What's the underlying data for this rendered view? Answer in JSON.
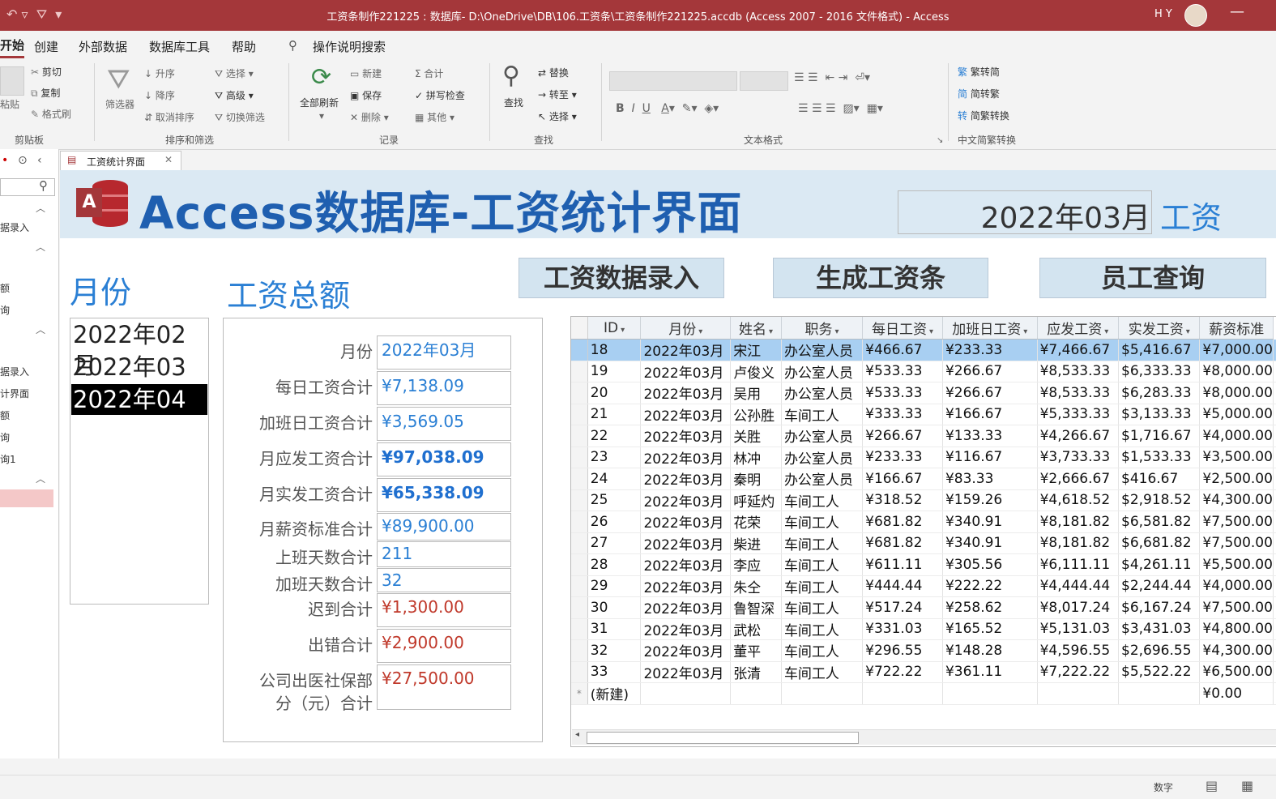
{
  "window": {
    "title": "工资条制作221225 : 数据库- D:\\OneDrive\\DB\\106.工资条\\工资条制作221225.accdb (Access 2007 - 2016 文件格式) - Access",
    "user": "H Y"
  },
  "menu": {
    "home": "开始",
    "create": "创建",
    "external": "外部数据",
    "dbtools": "数据库工具",
    "help": "帮助",
    "search": "操作说明搜索"
  },
  "ribbon": {
    "clipboard": {
      "paste": "粘贴",
      "cut": "剪切",
      "copy": "复制",
      "format_painter": "格式刷",
      "label": "剪贴板"
    },
    "sort": {
      "filter": "筛选器",
      "asc": "升序",
      "desc": "降序",
      "clear": "取消排序",
      "select": "选择",
      "advanced": "高级",
      "toggle": "切换筛选",
      "label": "排序和筛选"
    },
    "records": {
      "refresh": "全部刷新",
      "new": "新建",
      "save": "保存",
      "delete": "删除",
      "total": "合计",
      "spell": "拼写检查",
      "more": "其他",
      "label": "记录"
    },
    "find": {
      "find": "查找",
      "replace": "替换",
      "goto": "转至",
      "select": "选择",
      "label": "查找"
    },
    "text": {
      "label": "文本格式"
    },
    "chinese": {
      "t2s": "繁转简",
      "s2t": "简转繁",
      "convert": "简繁转换",
      "label": "中文简繁转换"
    }
  },
  "nav": {
    "items": [
      "据录入",
      "额",
      "询",
      "据录入",
      "计界面",
      "额",
      "询",
      "询1"
    ]
  },
  "doc_tab": "工资统计界面",
  "form": {
    "title": "Access数据库-工资统计界面",
    "current_month": "2022年03月",
    "wage_label": "工资",
    "buttons": {
      "entry": "工资数据录入",
      "slip": "生成工资条",
      "query": "员工查询"
    },
    "month_label": "月份",
    "total_label": "工资总额",
    "months": [
      "2022年02月",
      "2022年03月",
      "2022年04月"
    ],
    "summary": [
      {
        "label": "月份",
        "value": "2022年03月"
      },
      {
        "label": "每日工资合计",
        "value": "¥7,138.09"
      },
      {
        "label": "加班日工资合计",
        "value": "¥3,569.05"
      },
      {
        "label": "月应发工资合计",
        "value": "¥97,038.09"
      },
      {
        "label": "月实发工资合计",
        "value": "¥65,338.09"
      },
      {
        "label": "月薪资标准合计",
        "value": "¥89,900.00"
      },
      {
        "label": "上班天数合计",
        "value": "211"
      },
      {
        "label": "加班天数合计",
        "value": "32"
      },
      {
        "label": "迟到合计",
        "value": "¥1,300.00"
      },
      {
        "label": "出错合计",
        "value": "¥2,900.00"
      },
      {
        "label": "公司出医社保部",
        "value": "¥27,500.00"
      },
      {
        "label": "分（元）合计",
        "value": ""
      }
    ]
  },
  "datasheet": {
    "columns": [
      "ID",
      "月份",
      "姓名",
      "职务",
      "每日工资",
      "加班日工资",
      "应发工资",
      "实发工资",
      "薪资标准"
    ],
    "rows": [
      [
        "18",
        "2022年03月",
        "宋江",
        "办公室人员",
        "¥466.67",
        "¥233.33",
        "¥7,466.67",
        "$5,416.67",
        "¥7,000.00"
      ],
      [
        "19",
        "2022年03月",
        "卢俊义",
        "办公室人员",
        "¥533.33",
        "¥266.67",
        "¥8,533.33",
        "$6,333.33",
        "¥8,000.00"
      ],
      [
        "20",
        "2022年03月",
        "吴用",
        "办公室人员",
        "¥533.33",
        "¥266.67",
        "¥8,533.33",
        "$6,283.33",
        "¥8,000.00"
      ],
      [
        "21",
        "2022年03月",
        "公孙胜",
        "车间工人",
        "¥333.33",
        "¥166.67",
        "¥5,333.33",
        "$3,133.33",
        "¥5,000.00"
      ],
      [
        "22",
        "2022年03月",
        "关胜",
        "办公室人员",
        "¥266.67",
        "¥133.33",
        "¥4,266.67",
        "$1,716.67",
        "¥4,000.00"
      ],
      [
        "23",
        "2022年03月",
        "林冲",
        "办公室人员",
        "¥233.33",
        "¥116.67",
        "¥3,733.33",
        "$1,533.33",
        "¥3,500.00"
      ],
      [
        "24",
        "2022年03月",
        "秦明",
        "办公室人员",
        "¥166.67",
        "¥83.33",
        "¥2,666.67",
        "$416.67",
        "¥2,500.00"
      ],
      [
        "25",
        "2022年03月",
        "呼延灼",
        "车间工人",
        "¥318.52",
        "¥159.26",
        "¥4,618.52",
        "$2,918.52",
        "¥4,300.00"
      ],
      [
        "26",
        "2022年03月",
        "花荣",
        "车间工人",
        "¥681.82",
        "¥340.91",
        "¥8,181.82",
        "$6,581.82",
        "¥7,500.00"
      ],
      [
        "27",
        "2022年03月",
        "柴进",
        "车间工人",
        "¥681.82",
        "¥340.91",
        "¥8,181.82",
        "$6,681.82",
        "¥7,500.00"
      ],
      [
        "28",
        "2022年03月",
        "李应",
        "车间工人",
        "¥611.11",
        "¥305.56",
        "¥6,111.11",
        "$4,261.11",
        "¥5,500.00"
      ],
      [
        "29",
        "2022年03月",
        "朱仝",
        "车间工人",
        "¥444.44",
        "¥222.22",
        "¥4,444.44",
        "$2,244.44",
        "¥4,000.00"
      ],
      [
        "30",
        "2022年03月",
        "鲁智深",
        "车间工人",
        "¥517.24",
        "¥258.62",
        "¥8,017.24",
        "$6,167.24",
        "¥7,500.00"
      ],
      [
        "31",
        "2022年03月",
        "武松",
        "车间工人",
        "¥331.03",
        "¥165.52",
        "¥5,131.03",
        "$3,431.03",
        "¥4,800.00"
      ],
      [
        "32",
        "2022年03月",
        "董平",
        "车间工人",
        "¥296.55",
        "¥148.28",
        "¥4,596.55",
        "$2,696.55",
        "¥4,300.00"
      ],
      [
        "33",
        "2022年03月",
        "张清",
        "车间工人",
        "¥722.22",
        "¥361.11",
        "¥7,222.22",
        "$5,522.22",
        "¥6,500.00"
      ]
    ],
    "new_row": {
      "label": "(新建)",
      "salary": "¥0.00"
    }
  },
  "status": {
    "mode": "数字"
  }
}
